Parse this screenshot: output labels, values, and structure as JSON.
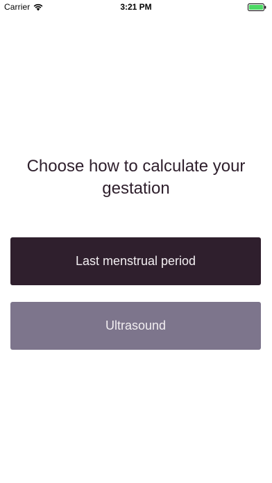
{
  "status_bar": {
    "carrier": "Carrier",
    "time": "3:21 PM",
    "icons": [
      "wifi-icon",
      "battery-icon"
    ],
    "battery_color": "#4cd964"
  },
  "main": {
    "prompt": "Choose how to calculate your gestation",
    "options": [
      {
        "label": "Last menstrual period",
        "color": "#2f1f2d"
      },
      {
        "label": "Ultrasound",
        "color": "#7d758c"
      }
    ]
  }
}
